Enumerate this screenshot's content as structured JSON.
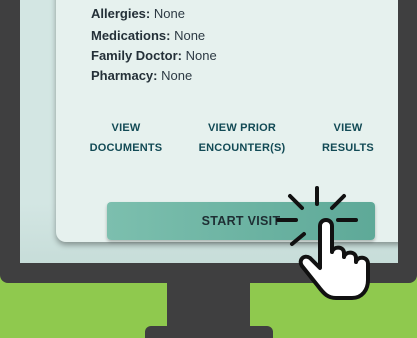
{
  "patient_info": [
    {
      "label": "Allergies:",
      "value": " None"
    },
    {
      "label": "Medications:",
      "value": " None"
    },
    {
      "label": "Family Doctor:",
      "value": " None"
    },
    {
      "label": "Pharmacy:",
      "value": " None"
    }
  ],
  "actions": {
    "view_documents": {
      "line1": "VIEW",
      "line2": "DOCUMENTS"
    },
    "view_prior_encounters": {
      "line1": "VIEW PRIOR",
      "line2": "ENCOUNTER(S)"
    },
    "view_results": {
      "line1": "VIEW",
      "line2": "RESULTS"
    }
  },
  "start_visit_label": "START VISIT",
  "icons": {
    "pointer": "pointing-hand-click-icon"
  },
  "colors": {
    "background": "#8fc94e",
    "monitor": "#3f3f40",
    "button": "#6db3a3",
    "link": "#124a55"
  }
}
